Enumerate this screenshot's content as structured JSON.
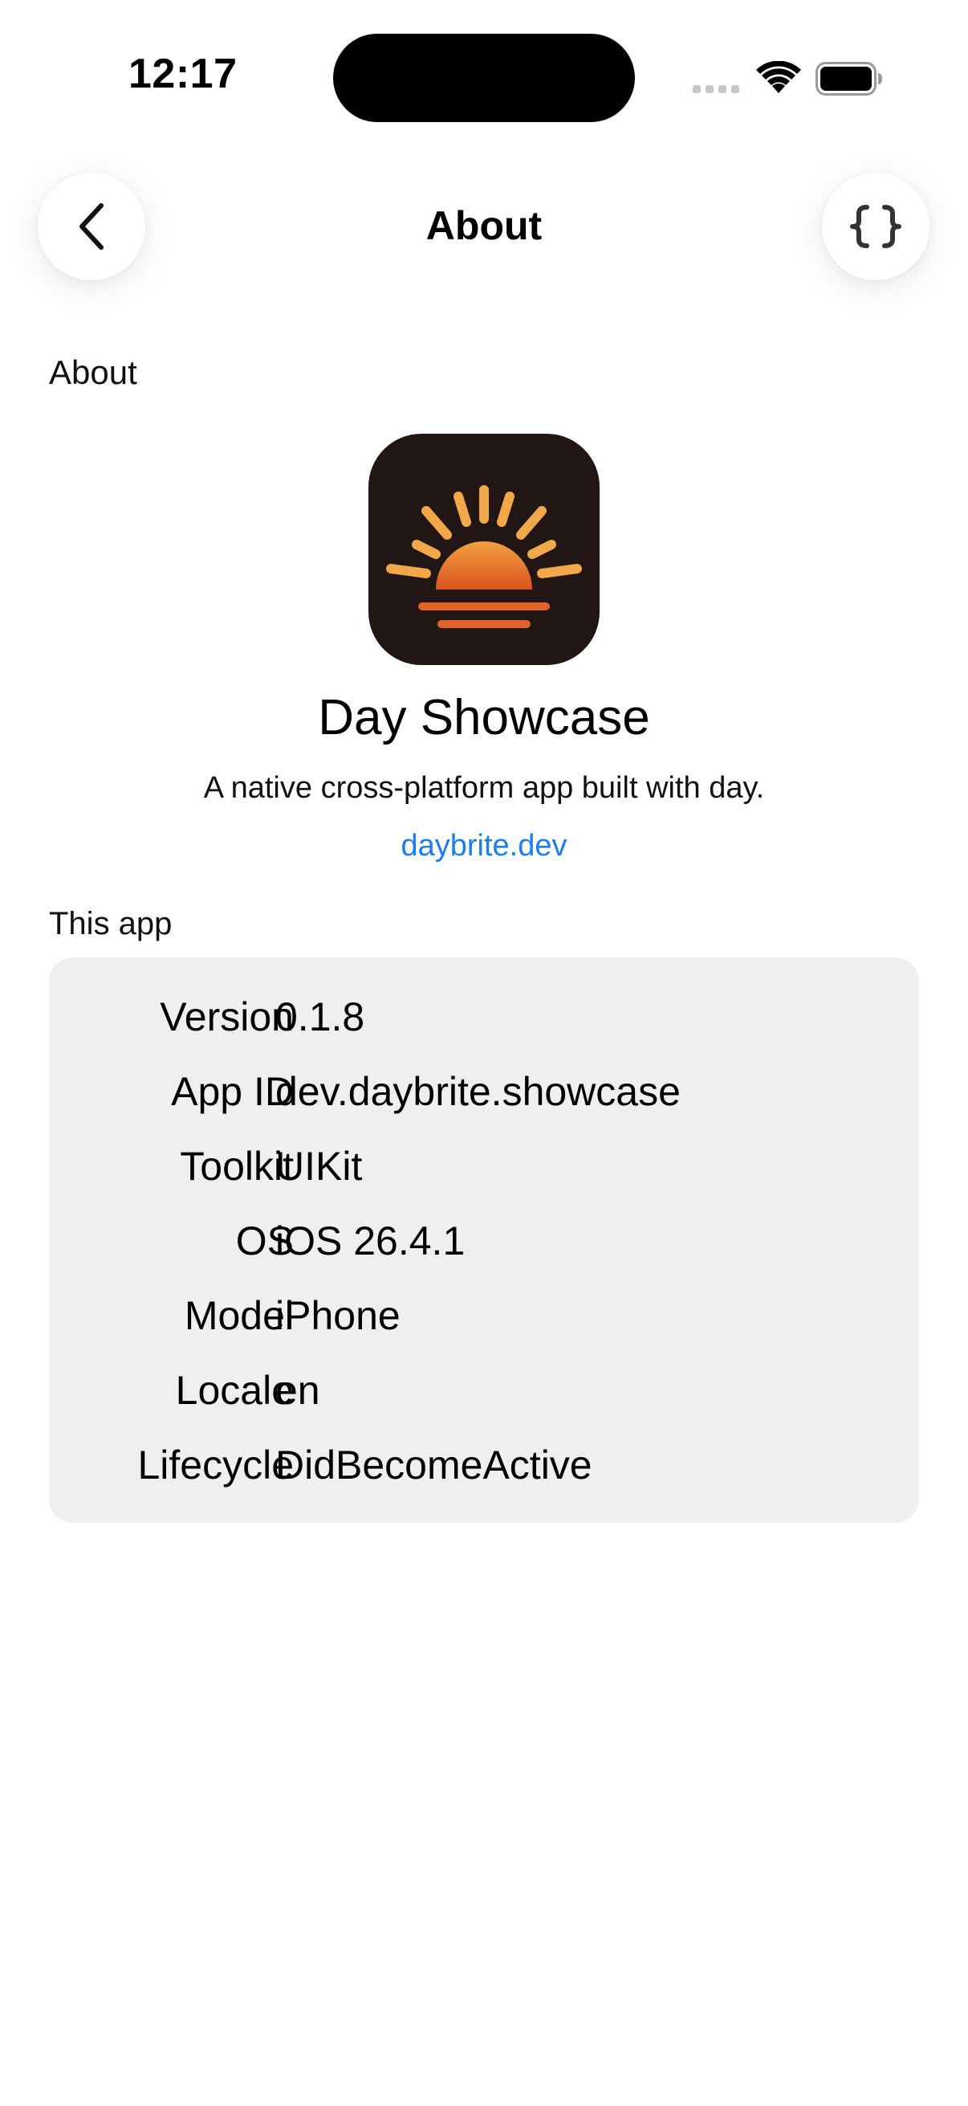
{
  "status_bar": {
    "time": "12:17",
    "icons": [
      "cellular-signal-icon",
      "wifi-icon",
      "battery-icon"
    ]
  },
  "nav": {
    "title": "About",
    "back_icon": "chevron-left-icon",
    "action_icon": "curly-braces-icon"
  },
  "about": {
    "heading": "About",
    "app_name": "Day Showcase",
    "description": "A native cross-platform app built with day.",
    "link": "daybrite.dev",
    "icon": "sunrise-app-icon"
  },
  "this_app": {
    "heading": "This app",
    "rows": [
      {
        "key": "Version",
        "value": "0.1.8"
      },
      {
        "key": "App ID",
        "value": "dev.daybrite.showcase"
      },
      {
        "key": "Toolkit",
        "value": "UIKit"
      },
      {
        "key": "OS",
        "value": "iOS 26.4.1"
      },
      {
        "key": "Model",
        "value": "iPhone"
      },
      {
        "key": "Locale",
        "value": "en"
      },
      {
        "key": "Lifecycle",
        "value": "DidBecomeActive"
      }
    ]
  },
  "colors": {
    "link": "#1a7ef2",
    "card_background": "#efefef",
    "icon_background": "#221614",
    "sun_orange": "#f0a040"
  }
}
